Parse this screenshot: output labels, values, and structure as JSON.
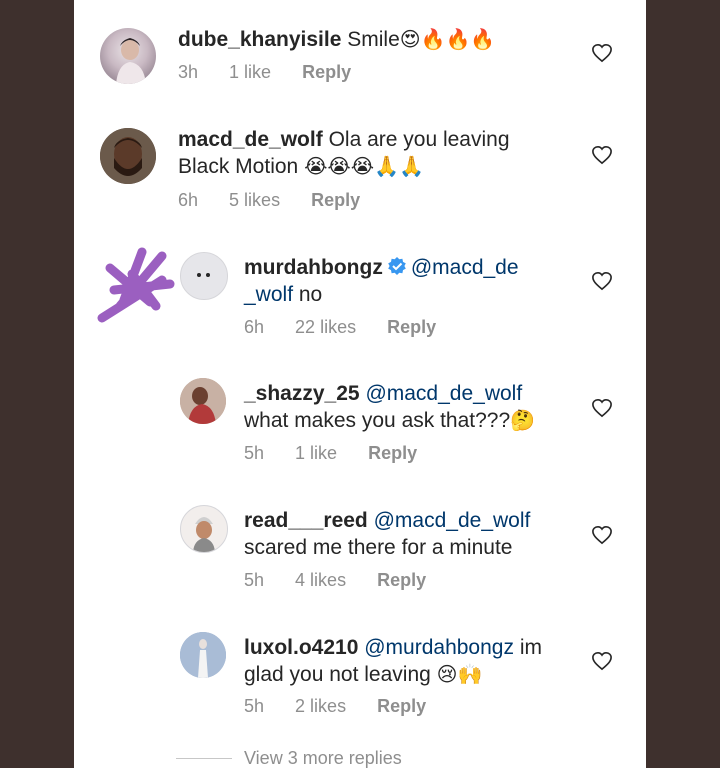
{
  "comments": [
    {
      "username": "dube_khanyisile",
      "text": "Smile",
      "emojis": "😍🔥🔥🔥",
      "time": "3h",
      "likes": "1 like",
      "reply": "Reply"
    },
    {
      "username": "macd_de_wolf",
      "text_line1": "Ola are you leaving",
      "text_line2": "Black Motion",
      "emojis": "😭😭😭🙏🙏",
      "time": "6h",
      "likes": "5 likes",
      "reply": "Reply"
    },
    {
      "username": "murdahbongz",
      "mention": "@macd_de",
      "mention_cont": "_wolf",
      "text": "no",
      "time": "6h",
      "likes": "22 likes",
      "reply": "Reply"
    },
    {
      "username": "_shazzy_25",
      "mention": "@macd_de_wolf",
      "text": "what makes you ask that???",
      "emojis": "🤔",
      "time": "5h",
      "likes": "1 like",
      "reply": "Reply"
    },
    {
      "username": "read___reed",
      "mention": "@macd_de_wolf",
      "text": "scared me there for a minute",
      "time": "5h",
      "likes": "4 likes",
      "reply": "Reply"
    },
    {
      "username": "luxol.o4210",
      "mention": "@murdahbongz",
      "text_tail": "im",
      "text_line2": "glad you not leaving",
      "emojis": "😢🙌",
      "time": "5h",
      "likes": "2 likes",
      "reply": "Reply"
    }
  ],
  "view_more": "View 3 more replies",
  "colors": {
    "background": "#3e302d",
    "panel": "#ffffff",
    "text": "#262626",
    "meta": "#8e8e8e",
    "mention": "#00376b",
    "verified": "#3897f0",
    "scribble": "#9b5fc0"
  }
}
